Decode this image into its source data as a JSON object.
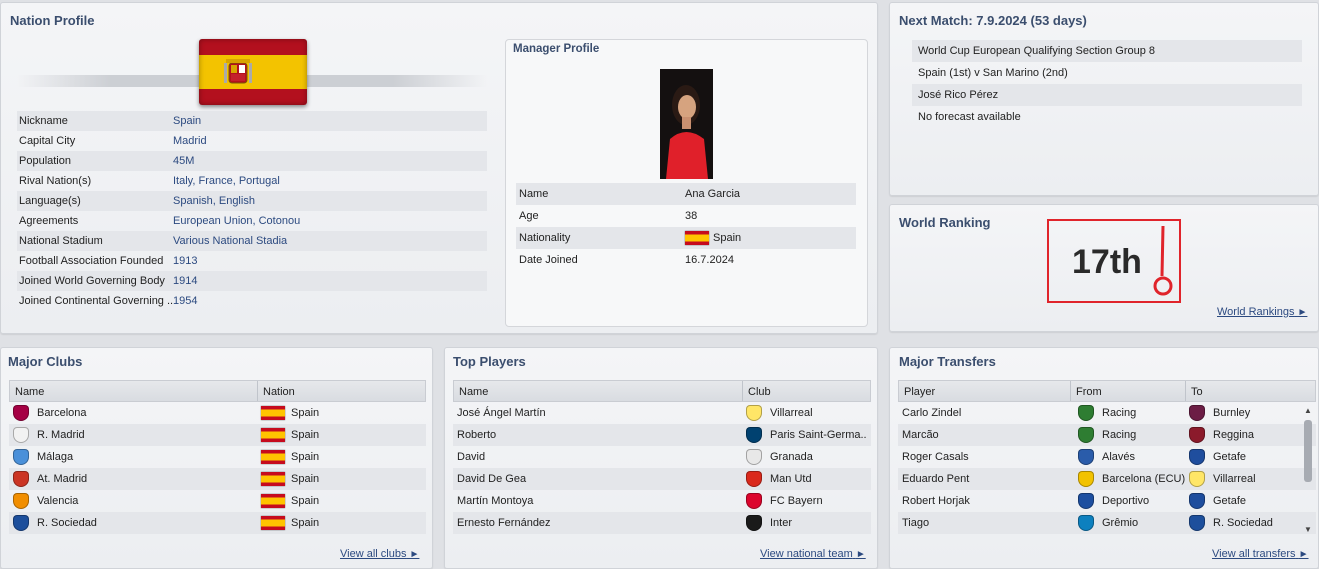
{
  "nation_profile": {
    "title": "Nation Profile",
    "rows": [
      {
        "label": "Nickname",
        "value": "Spain"
      },
      {
        "label": "Capital City",
        "value": "Madrid"
      },
      {
        "label": "Population",
        "value": "45M"
      },
      {
        "label": "Rival Nation(s)",
        "value": "Italy, France, Portugal"
      },
      {
        "label": "Language(s)",
        "value": "Spanish, English"
      },
      {
        "label": "Agreements",
        "value": "European Union, Cotonou"
      },
      {
        "label": "National Stadium",
        "value": "Various National Stadia"
      },
      {
        "label": "Football Association Founded",
        "value": "1913"
      },
      {
        "label": "Joined World Governing Body",
        "value": "1914"
      },
      {
        "label": "Joined Continental Governing ...",
        "value": "1954"
      }
    ]
  },
  "manager_profile": {
    "title": "Manager Profile",
    "rows": [
      {
        "label": "Name",
        "value": "Ana Garcia"
      },
      {
        "label": "Age",
        "value": "38"
      },
      {
        "label": "Nationality",
        "value": "Spain"
      },
      {
        "label": "Date Joined",
        "value": "16.7.2024"
      }
    ]
  },
  "next_match": {
    "title": "Next Match: 7.9.2024 (53 days)",
    "lines": [
      "World Cup European Qualifying Section Group 8",
      "Spain (1st) v San Marino (2nd)",
      "José Rico Pérez",
      "No forecast available"
    ]
  },
  "world_ranking": {
    "title": "World Ranking",
    "value": "17th",
    "annotation_color": "#e0242b",
    "link": "World Rankings"
  },
  "major_clubs": {
    "title": "Major Clubs",
    "columns": [
      "Name",
      "Nation"
    ],
    "rows": [
      {
        "name": "Barcelona",
        "nation": "Spain",
        "crest_color": "#a50044"
      },
      {
        "name": "R. Madrid",
        "nation": "Spain",
        "crest_color": "#f2f2f2"
      },
      {
        "name": "Málaga",
        "nation": "Spain",
        "crest_color": "#4a90d9"
      },
      {
        "name": "At. Madrid",
        "nation": "Spain",
        "crest_color": "#cb3524"
      },
      {
        "name": "Valencia",
        "nation": "Spain",
        "crest_color": "#f18e00"
      },
      {
        "name": "R. Sociedad",
        "nation": "Spain",
        "crest_color": "#1d4f9c"
      }
    ],
    "link": "View all clubs"
  },
  "top_players": {
    "title": "Top Players",
    "columns": [
      "Name",
      "Club"
    ],
    "rows": [
      {
        "name": "José Ángel Martín",
        "club": "Villarreal",
        "crest_color": "#ffe667"
      },
      {
        "name": "Roberto",
        "club": "Paris Saint-Germa..",
        "crest_color": "#004170"
      },
      {
        "name": "David",
        "club": "Granada",
        "crest_color": "#e8e8e8"
      },
      {
        "name": "David De Gea",
        "club": "Man Utd",
        "crest_color": "#da291c"
      },
      {
        "name": "Martín Montoya",
        "club": "FC Bayern",
        "crest_color": "#dc052d"
      },
      {
        "name": "Ernesto Fernández",
        "club": "Inter",
        "crest_color": "#1a1a1a"
      }
    ],
    "link": "View national team"
  },
  "major_transfers": {
    "title": "Major Transfers",
    "columns": [
      "Player",
      "From",
      "To"
    ],
    "rows": [
      {
        "player": "Carlo Zindel",
        "from": "Racing",
        "to": "Burnley",
        "from_color": "#2e7d32",
        "to_color": "#6c1d45"
      },
      {
        "player": "Marcão",
        "from": "Racing",
        "to": "Reggina",
        "from_color": "#2e7d32",
        "to_color": "#8b1a2b"
      },
      {
        "player": "Roger Casals",
        "from": "Alavés",
        "to": "Getafe",
        "from_color": "#2a5caa",
        "to_color": "#1f4e9e"
      },
      {
        "player": "Eduardo Pent",
        "from": "Barcelona (ECU)",
        "to": "Villarreal",
        "from_color": "#f2c200",
        "to_color": "#ffe667"
      },
      {
        "player": "Robert Horjak",
        "from": "Deportivo",
        "to": "Getafe",
        "from_color": "#1d4fa0",
        "to_color": "#1f4e9e"
      },
      {
        "player": "Tiago",
        "from": "Grêmio",
        "to": "R. Sociedad",
        "from_color": "#0d80bf",
        "to_color": "#1d4f9c"
      }
    ],
    "link": "View all transfers"
  }
}
